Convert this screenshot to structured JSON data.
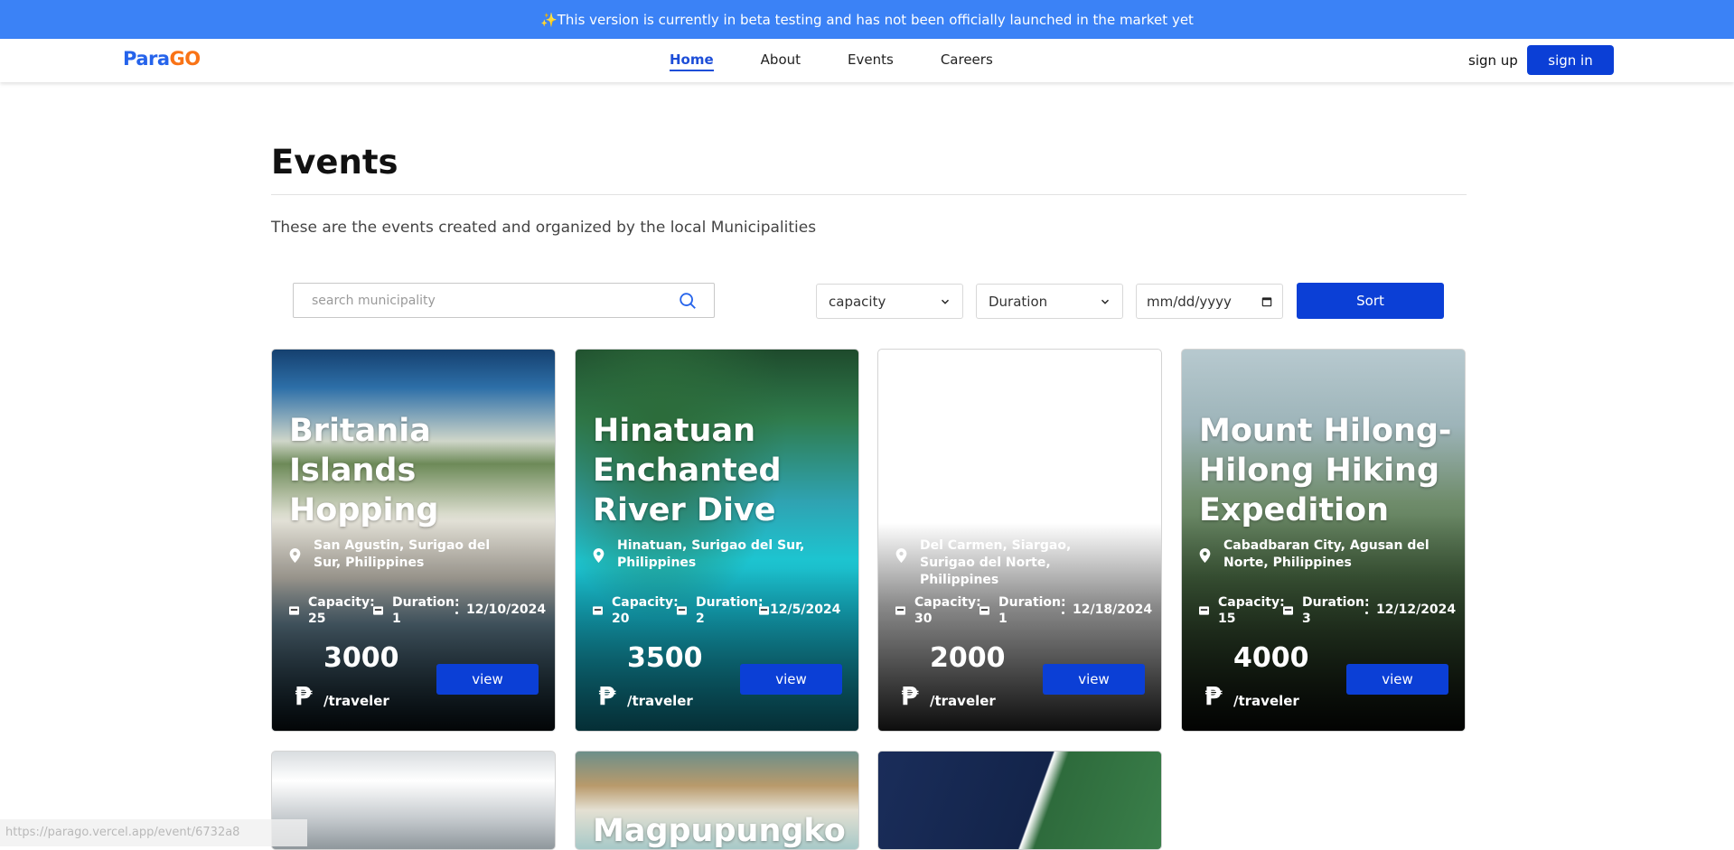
{
  "banner": {
    "icon": "sparkles-icon",
    "text": "✨This version is currently in beta testing and has not been officially launched in the market yet"
  },
  "nav": {
    "logo": "ParaGO",
    "links": [
      "Home",
      "About",
      "Events",
      "Careers"
    ],
    "active": "Home",
    "signup": "sign up",
    "signin": "sign in"
  },
  "header": {
    "title": "Events",
    "subtitle": "These are the events created and organized by the local Municipalities"
  },
  "filters": {
    "search_placeholder": "search municipality",
    "capacity": "capacity",
    "duration": "Duration",
    "date_placeholder": "mm/dd/yyyy",
    "sort": "Sort"
  },
  "events": [
    {
      "title": "Britania Islands Hopping",
      "location": "San Agustin, Surigao del Sur, Philippines",
      "capacity_label": "Capacity:",
      "capacity": "25",
      "duration_label": "Duration:",
      "duration": "1",
      "date": "12/10/2024",
      "price": "3000",
      "currency": "₱",
      "per": "/traveler",
      "view": "view"
    },
    {
      "title": "Hinatuan Enchanted River Dive",
      "location": "Hinatuan, Surigao del Sur, Philippines",
      "capacity_label": "Capacity:",
      "capacity": "20",
      "duration_label": "Duration:",
      "duration": "2",
      "date": "12/5/2024",
      "price": "3500",
      "currency": "₱",
      "per": "/traveler",
      "view": "view"
    },
    {
      "title": "",
      "location": "Del Carmen, Siargao, Surigao del Norte, Philippines",
      "capacity_label": "Capacity:",
      "capacity": "30",
      "duration_label": "Duration:",
      "duration": "1",
      "date": "12/18/2024",
      "price": "2000",
      "currency": "₱",
      "per": "/traveler",
      "view": "view"
    },
    {
      "title": "Mount Hilong-Hilong Hiking Expedition",
      "location": "Cabadbaran City, Agusan del Norte, Philippines",
      "capacity_label": "Capacity:",
      "capacity": "15",
      "duration_label": "Duration:",
      "duration": "3",
      "date": "12/12/2024",
      "price": "4000",
      "currency": "₱",
      "per": "/traveler",
      "view": "view"
    }
  ],
  "row2": [
    {
      "title": ""
    },
    {
      "title": "Magpupungko"
    },
    {
      "title": ""
    }
  ],
  "status_url": "https://parago.vercel.app/event/6732a8"
}
